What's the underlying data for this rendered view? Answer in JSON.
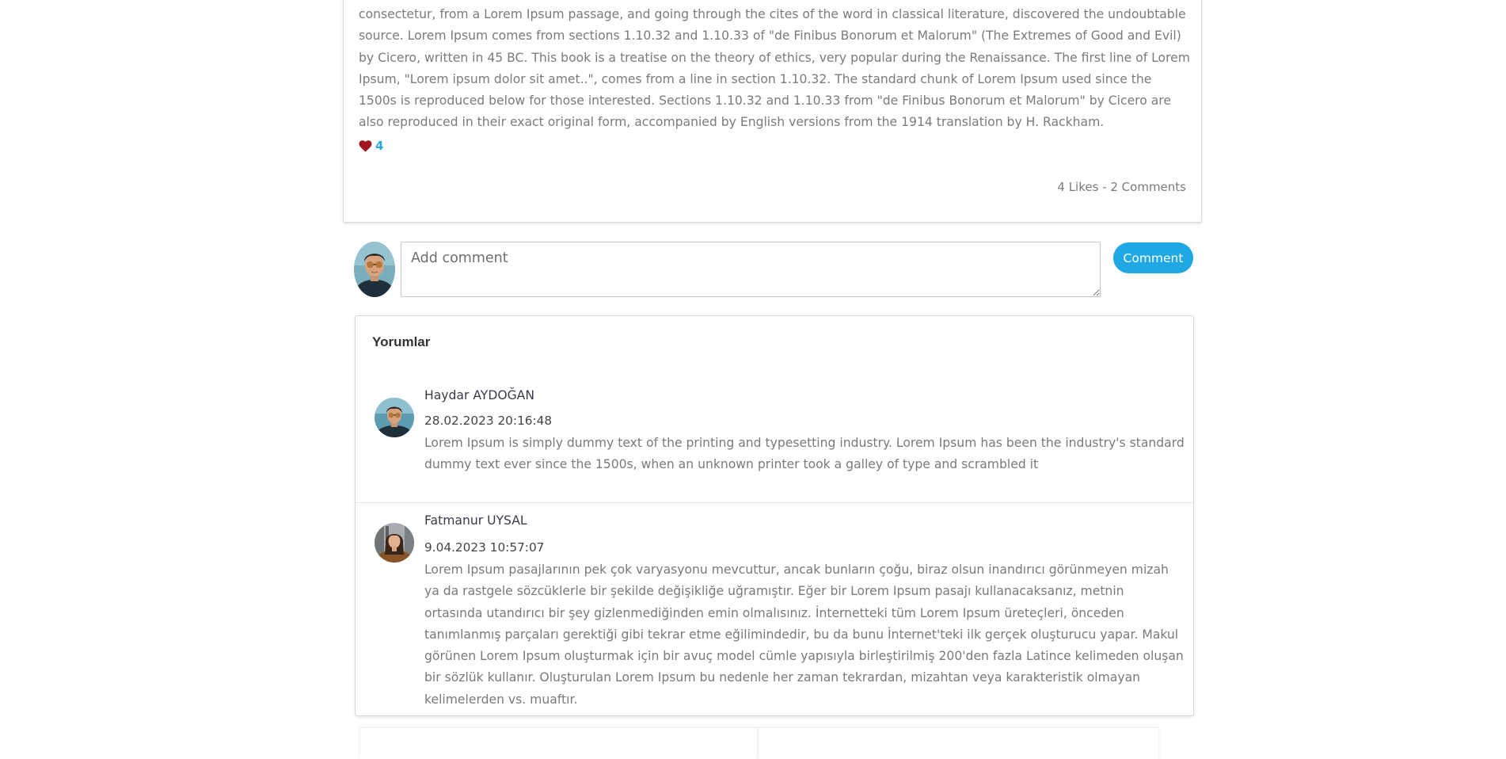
{
  "post": {
    "text": "consectetur, from a Lorem Ipsum passage, and going through the cites of the word in classical literature, discovered the undoubtable source. Lorem Ipsum comes from sections 1.10.32 and 1.10.33 of \"de Finibus Bonorum et Malorum\" (The Extremes of Good and Evil) by Cicero, written in 45 BC. This book is a treatise on the theory of ethics, very popular during the Renaissance. The first line of Lorem Ipsum, \"Lorem ipsum dolor sit amet..\", comes from a line in section 1.10.32. The standard chunk of Lorem Ipsum used since the 1500s is reproduced below for those interested. Sections 1.10.32 and 1.10.33 from \"de Finibus Bonorum et Malorum\" by Cicero are also reproduced in their exact original form, accompanied by English versions from the 1914 translation by H. Rackham.",
    "like_icon": "heart-icon",
    "like_count": "4",
    "stats": "4 Likes - 2 Comments"
  },
  "comment_form": {
    "placeholder": "Add comment",
    "button_label": "Comment"
  },
  "comments": {
    "title": "Yorumlar",
    "items": [
      {
        "author": "Haydar AYDOĞAN",
        "date": "28.02.2023 20:16:48",
        "text": "Lorem Ipsum is simply dummy text of the printing and typesetting industry. Lorem Ipsum has been the industry's standard dummy text ever since the 1500s, when an unknown printer took a galley of type and scrambled it"
      },
      {
        "author": "Fatmanur UYSAL",
        "date": "9.04.2023 10:57:07",
        "text": "Lorem Ipsum pasajlarının pek çok varyasyonu mevcuttur, ancak bunların çoğu, biraz olsun inandırıcı görünmeyen mizah ya da rastgele sözcüklerle bir şekilde değişikliğe uğramıştır. Eğer bir Lorem Ipsum pasajı kullanacaksanız, metnin ortasında utandırıcı bir şey gizlenmediğinden emin olmalısınız. İnternetteki tüm Lorem Ipsum üreteçleri, önceden tanımlanmış parçaları gerektiği gibi tekrar etme eğilimindedir, bu da bunu İnternet'teki ilk gerçek oluşturucu yapar. Makul görünen Lorem Ipsum oluşturmak için bir avuç model cümle yapısıyla birleştirilmiş 200'den fazla Latince kelimeden oluşan bir sözlük kullanır. Oluşturulan Lorem Ipsum bu nedenle her zaman tekrardan, mizahtan veya karakteristik olmayan kelimelerden vs. muaftır."
      }
    ]
  },
  "colors": {
    "accent": "#1fa8e3",
    "like_count": "#29a8df",
    "heart": "#a0151e"
  }
}
